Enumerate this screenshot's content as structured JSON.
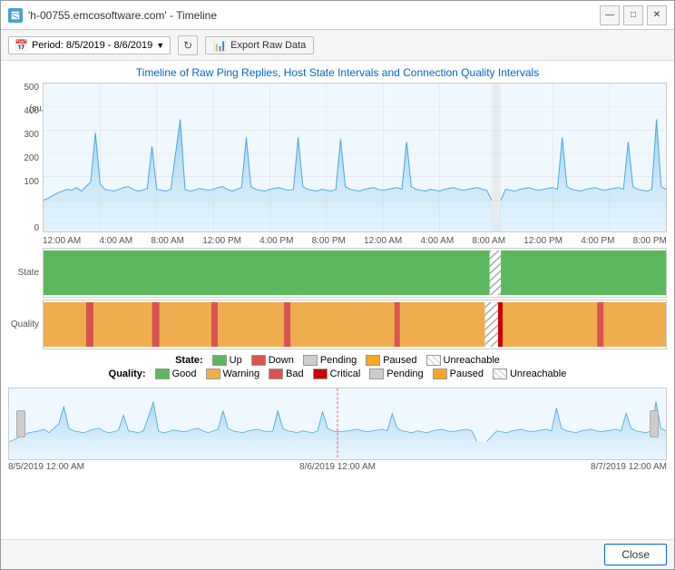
{
  "window": {
    "title": "'h-00755.emcosoftware.com' - Timeline"
  },
  "toolbar": {
    "period_label": "Period: 8/5/2019 - 8/6/2019",
    "export_label": "Export Raw Data"
  },
  "chart": {
    "title": "Timeline of Raw Ping Replies, Host State Intervals and Connection Quality Intervals",
    "y_axis_label": "Latency (ms)",
    "y_ticks": [
      "500",
      "400",
      "300",
      "200",
      "100",
      "0"
    ],
    "x_ticks": [
      "12:00 AM",
      "4:00 AM",
      "8:00 AM",
      "12:00 PM",
      "4:00 PM",
      "8:00 PM",
      "12:00 AM",
      "4:00 AM",
      "8:00 AM",
      "12:00 PM",
      "4:00 PM",
      "8:00 PM"
    ]
  },
  "legend_state": {
    "label": "State:",
    "items": [
      {
        "label": "Up",
        "color": "#5cb85c",
        "type": "solid"
      },
      {
        "label": "Down",
        "color": "#d9534f",
        "type": "solid"
      },
      {
        "label": "Pending",
        "color": "#cccccc",
        "type": "solid"
      },
      {
        "label": "Paused",
        "color": "#f0ad4e",
        "type": "solid"
      },
      {
        "label": "Unreachable",
        "color": "",
        "type": "hatched"
      }
    ]
  },
  "legend_quality": {
    "label": "Quality:",
    "items": [
      {
        "label": "Good",
        "color": "#5cb85c",
        "type": "solid"
      },
      {
        "label": "Warning",
        "color": "#f0ad4e",
        "type": "solid"
      },
      {
        "label": "Bad",
        "color": "#d9534f",
        "type": "solid"
      },
      {
        "label": "Critical",
        "color": "#cc0000",
        "type": "solid"
      },
      {
        "label": "Pending",
        "color": "#cccccc",
        "type": "solid"
      },
      {
        "label": "Paused",
        "color": "#f5a623",
        "type": "solid"
      },
      {
        "label": "Unreachable",
        "color": "",
        "type": "hatched"
      }
    ]
  },
  "mini_timeline": {
    "time_labels": [
      "8/5/2019 12:00 AM",
      "8/6/2019 12:00 AM",
      "8/7/2019 12:00 AM"
    ]
  },
  "footer": {
    "close_label": "Close"
  },
  "icons": {
    "calendar": "📅",
    "refresh": "↻",
    "export": "📊",
    "minimize": "—",
    "maximize": "□",
    "close": "✕"
  }
}
